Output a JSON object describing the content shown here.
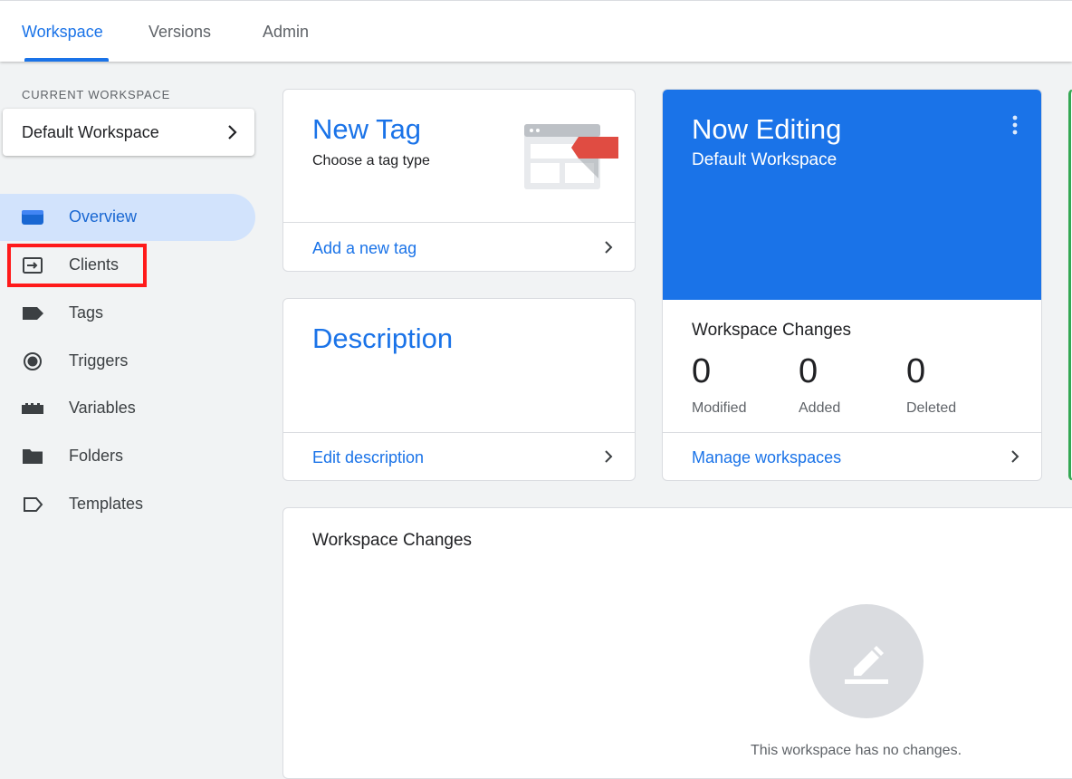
{
  "tabs": [
    {
      "label": "Workspace",
      "active": true
    },
    {
      "label": "Versions",
      "active": false
    },
    {
      "label": "Admin",
      "active": false
    }
  ],
  "sidebar": {
    "current_workspace_label": "CURRENT WORKSPACE",
    "workspace_name": "Default Workspace",
    "items": [
      {
        "label": "Overview",
        "icon": "overview-icon",
        "active": true
      },
      {
        "label": "Clients",
        "icon": "clients-icon",
        "active": false,
        "highlighted": true
      },
      {
        "label": "Tags",
        "icon": "tag-icon",
        "active": false
      },
      {
        "label": "Triggers",
        "icon": "triggers-icon",
        "active": false
      },
      {
        "label": "Variables",
        "icon": "variables-icon",
        "active": false
      },
      {
        "label": "Folders",
        "icon": "folder-icon",
        "active": false
      },
      {
        "label": "Templates",
        "icon": "templates-icon",
        "active": false
      }
    ]
  },
  "new_tag_card": {
    "title": "New Tag",
    "subtitle": "Choose a tag type",
    "link": "Add a new tag"
  },
  "description_card": {
    "title": "Description",
    "link": "Edit description"
  },
  "now_editing_card": {
    "title": "Now Editing",
    "workspace": "Default Workspace",
    "changes_heading": "Workspace Changes",
    "stats": [
      {
        "value": "0",
        "label": "Modified"
      },
      {
        "value": "0",
        "label": "Added"
      },
      {
        "value": "0",
        "label": "Deleted"
      }
    ],
    "link": "Manage workspaces"
  },
  "changes_card": {
    "title": "Workspace Changes",
    "empty_message": "This workspace has no changes."
  },
  "colors": {
    "accent": "#1a73e8",
    "highlight_box": "#ff1a1a",
    "tag_red": "#e04c42"
  }
}
